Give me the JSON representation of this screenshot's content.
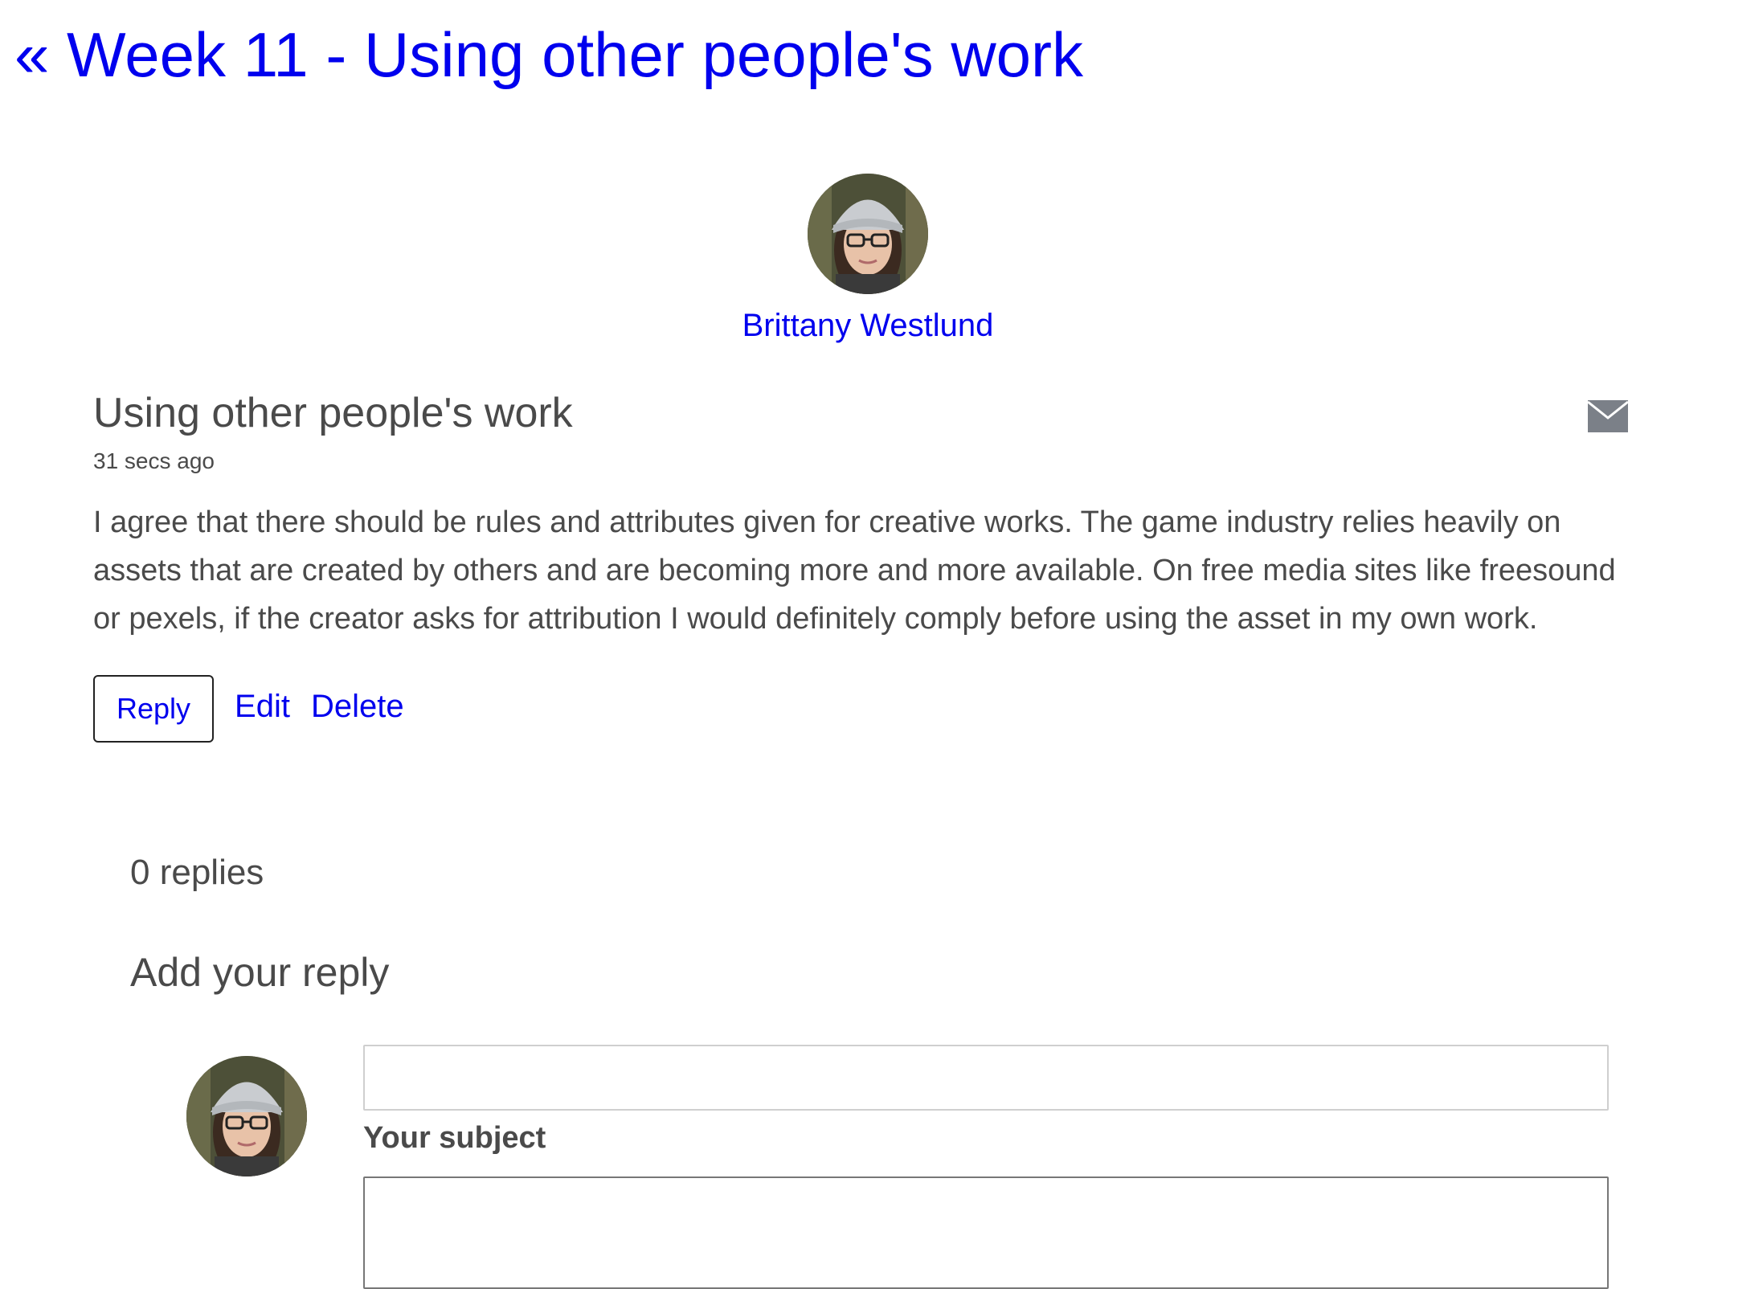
{
  "navigation": {
    "back_link": "« Week 11 - Using other people's work"
  },
  "author": {
    "name": "Brittany Westlund",
    "avatar_icon": "user-photo"
  },
  "post": {
    "title": "Using other people's work",
    "timestamp": "31 secs ago",
    "body": "I agree that there should be rules and attributes given for creative works. The game industry relies heavily on assets that are created by others and are becoming more and more available. On free media sites like freesound or pexels, if the creator asks for attribution I would definitely comply before using the asset in my own work.",
    "mail_icon": "envelope-icon"
  },
  "actions": {
    "reply_label": "Reply",
    "edit_label": "Edit",
    "delete_label": "Delete"
  },
  "replies": {
    "count_label": "0 replies"
  },
  "reply_form": {
    "heading": "Add your reply",
    "subject_label": "Your subject",
    "subject_value": "",
    "body_value": ""
  },
  "colors": {
    "link": "#0000ee",
    "text": "#4a4a4a",
    "icon": "#7b8088"
  }
}
